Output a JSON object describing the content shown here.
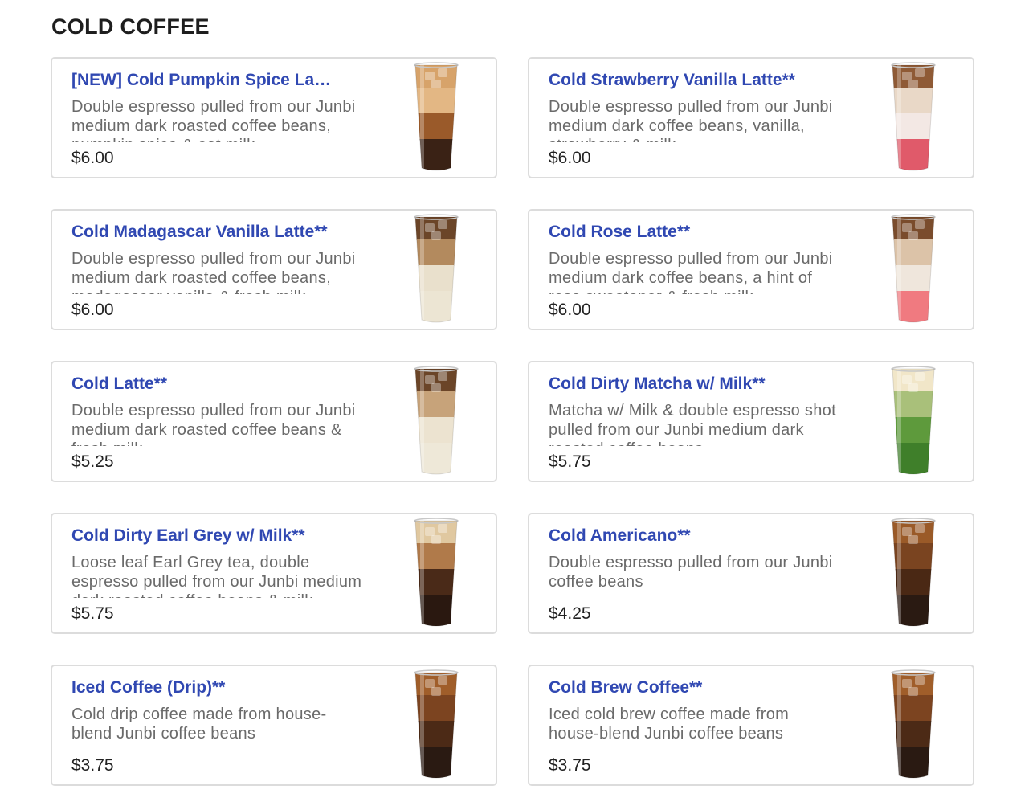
{
  "section": {
    "title": "COLD COFFEE"
  },
  "items": [
    {
      "name": "[NEW] Cold Pumpkin Spice La…",
      "desc": "Double espresso pulled from our Junbi medium dark roasted coffee beans, pumpkin spice & oat milk",
      "price": "$6.00",
      "image": "pumpkin-spice-latte-photo",
      "layers": [
        "#d7a36a",
        "#e3b784",
        "#9a5a2a",
        "#3a2215"
      ]
    },
    {
      "name": "Cold Strawberry Vanilla Latte**",
      "desc": "Double espresso pulled from our Junbi medium dark coffee beans, vanilla, strawberry & milk",
      "price": "$6.00",
      "image": "strawberry-vanilla-latte-photo",
      "layers": [
        "#8f5a35",
        "#e9d8c7",
        "#f3e8e4",
        "#e05a6a"
      ]
    },
    {
      "name": "Cold Madagascar Vanilla Latte**",
      "desc": "Double espresso pulled from our Junbi medium dark roasted coffee beans, madagascar vanilla & fresh milk",
      "price": "$6.00",
      "image": "madagascar-vanilla-latte-photo",
      "layers": [
        "#6b4528",
        "#b38a5e",
        "#e9e0cc",
        "#ece5d3"
      ]
    },
    {
      "name": "Cold Rose Latte**",
      "desc": "Double espresso pulled from our Junbi medium dark coffee beans, a hint of rose sweetener & fresh milk",
      "price": "$6.00",
      "image": "rose-latte-photo",
      "layers": [
        "#7a4c2c",
        "#dcc3a8",
        "#efe6dc",
        "#f07a80"
      ]
    },
    {
      "name": "Cold Latte**",
      "desc": "Double espresso pulled from our Junbi medium dark roasted coffee beans & fresh milk",
      "price": "$5.25",
      "image": "cold-latte-photo",
      "layers": [
        "#6b4528",
        "#c7a37a",
        "#ece3d0",
        "#eee8d8"
      ]
    },
    {
      "name": "Cold Dirty Matcha w/ Milk**",
      "desc": "Matcha w/ Milk & double espresso shot pulled from our Junbi medium dark roasted coffee beans",
      "price": "$5.75",
      "image": "dirty-matcha-photo",
      "layers": [
        "#f1e6c8",
        "#a9c07a",
        "#5e9a3c",
        "#3f7f2a"
      ]
    },
    {
      "name": "Cold Dirty Earl Grey w/ Milk**",
      "desc": "Loose leaf Earl Grey tea, double espresso pulled from our Junbi medium dark roasted coffee beans & milk",
      "price": "$5.75",
      "image": "dirty-earl-grey-photo",
      "layers": [
        "#e0c8a0",
        "#b07a4a",
        "#4a2a18",
        "#2a1810"
      ]
    },
    {
      "name": "Cold Americano**",
      "desc": "Double espresso pulled from our Junbi coffee beans",
      "price": "$4.25",
      "image": "cold-americano-photo",
      "layers": [
        "#9a5a28",
        "#7a4420",
        "#4a2814",
        "#2a1a12"
      ]
    },
    {
      "name": "Iced Coffee (Drip)**",
      "desc": "Cold drip coffee made from house-blend Junbi coffee beans",
      "price": "$3.75",
      "image": "iced-coffee-photo",
      "layers": [
        "#a05e2a",
        "#7c4420",
        "#4c2a16",
        "#2a1a12"
      ]
    },
    {
      "name": "Cold Brew Coffee**",
      "desc": "Iced cold brew coffee made from house-blend Junbi coffee beans",
      "price": "$3.75",
      "image": "cold-brew-photo",
      "layers": [
        "#a05e2a",
        "#7c4420",
        "#4c2a16",
        "#2a1a12"
      ]
    }
  ]
}
